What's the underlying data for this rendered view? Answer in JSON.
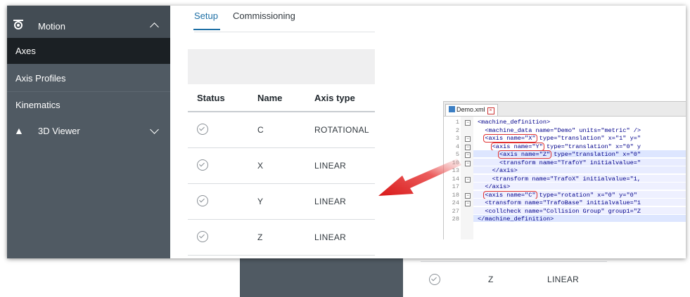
{
  "sidebar": {
    "header": {
      "label": "Motion",
      "icon": "motion-icon"
    },
    "items": [
      {
        "label": "Axes",
        "active": true
      },
      {
        "label": "Axis Profiles",
        "active": false
      },
      {
        "label": "Kinematics",
        "active": false
      }
    ],
    "viewer": {
      "label": "3D Viewer",
      "icon": "3d-viewer-icon"
    }
  },
  "tabs": {
    "setup": "Setup",
    "commissioning": "Commissioning"
  },
  "table": {
    "headers": {
      "status": "Status",
      "name": "Name",
      "type": "Axis type"
    },
    "rows": [
      {
        "name": "C",
        "type": "ROTATIONAL"
      },
      {
        "name": "X",
        "type": "LINEAR"
      },
      {
        "name": "Y",
        "type": "LINEAR"
      },
      {
        "name": "Z",
        "type": "LINEAR"
      }
    ]
  },
  "background_row": {
    "name": "Z",
    "type": "LINEAR"
  },
  "editor": {
    "tab_label": "Demo.xml",
    "line_numbers": [
      "1",
      "2",
      "3",
      "4",
      "5",
      "10",
      "13",
      "14",
      "17",
      "18",
      "24",
      "27",
      "28"
    ],
    "lines": [
      "<machine_definition>",
      "  <machine_data name=\"Demo\" units=\"metric\" />",
      "  <axis name=\"X\" type=\"translation\" x=\"1\" y=\"",
      "    <axis name=\"Y\" type=\"translation\" x=\"0\" y",
      "      <axis name=\"Z\" type=\"translation\" x=\"0\"",
      "      <transform name=\"TrafoY\" initialvalue=\"",
      "    </axis>",
      "    <transform name=\"TrafoX\" initialvalue=\"1,",
      "  </axis>",
      "  <axis name=\"C\" type=\"rotation\" x=\"0\" y=\"0\"",
      "  <transform name=\"TrafoBase\" initialvalue=\"1",
      "  <collcheck name=\"Collision Group\" group1=\"Z",
      "</machine_definition>"
    ]
  },
  "colors": {
    "sidebar": "#505a63",
    "active": "#1b2024",
    "accent": "#1d6fa5",
    "highlight": "#e03030"
  }
}
